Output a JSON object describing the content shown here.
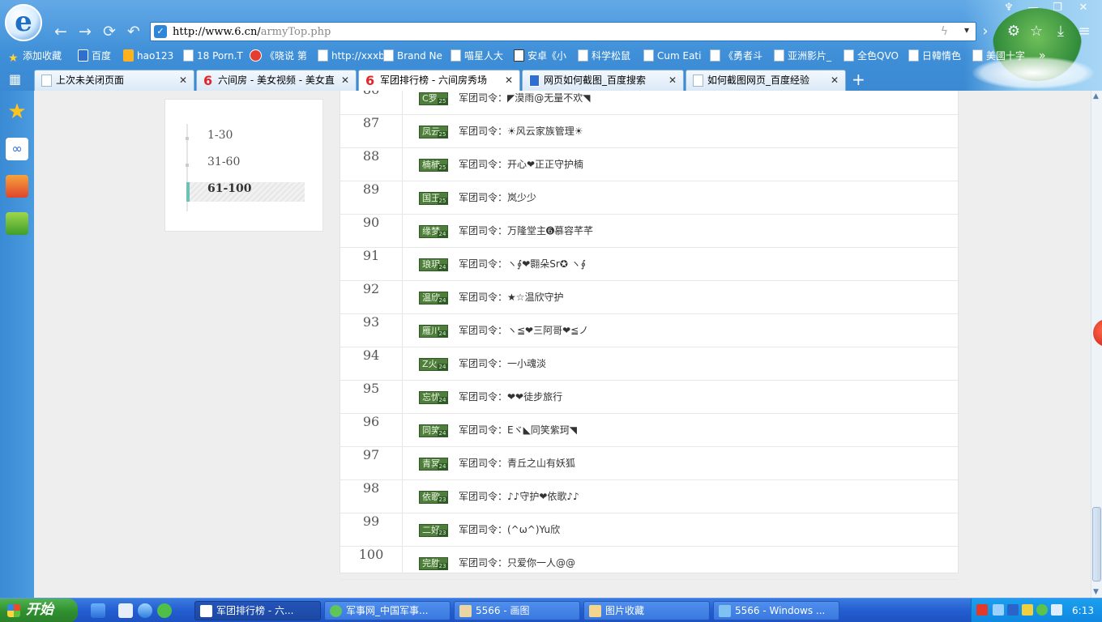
{
  "browser": {
    "logo": "e",
    "address": {
      "host": "http://www.6.cn/",
      "path": "armyTop.php"
    },
    "nav_icons": [
      "back-icon",
      "forward-icon",
      "refresh-icon",
      "undo-icon"
    ],
    "right_icons": [
      "more-icon",
      "gear-icon",
      "star-icon",
      "download-icon",
      "menu-icon"
    ]
  },
  "bookmarks": [
    {
      "label": "添加收藏",
      "icon": "star"
    },
    {
      "label": "百度",
      "icon": "paw"
    },
    {
      "label": "hao123",
      "icon": "hao"
    },
    {
      "label": "18 Porn.T",
      "icon": "page"
    },
    {
      "label": "《晓说 第",
      "icon": "red"
    },
    {
      "label": "http://xxxb",
      "icon": "page"
    },
    {
      "label": "Brand Ne",
      "icon": "page"
    },
    {
      "label": "喵星人大",
      "icon": "page"
    },
    {
      "label": "安卓《小",
      "icon": "check"
    },
    {
      "label": "科学松鼠",
      "icon": "page"
    },
    {
      "label": "Cum Eati",
      "icon": "page"
    },
    {
      "label": "《勇者斗",
      "icon": "page"
    },
    {
      "label": "亚洲影片_",
      "icon": "page"
    },
    {
      "label": "全色QVO",
      "icon": "page"
    },
    {
      "label": "日韓情色",
      "icon": "page"
    },
    {
      "label": "美國十字",
      "icon": "page"
    }
  ],
  "bookmarks_more": "»",
  "tabs": [
    {
      "label": "上次未关闭页面",
      "icon": "page",
      "active": false
    },
    {
      "label": "六间房 - 美女视频 - 美女直",
      "icon": "six",
      "active": false
    },
    {
      "label": "军团排行榜 - 六间房秀场",
      "icon": "six",
      "active": true
    },
    {
      "label": "网页如何截图_百度搜索",
      "icon": "paw",
      "active": false
    },
    {
      "label": "如何截图网页_百度经验",
      "icon": "page",
      "active": false
    }
  ],
  "tab_close": "✕",
  "new_tab": "+",
  "subnav": [
    {
      "label": "1-30",
      "active": false
    },
    {
      "label": "31-60",
      "active": false
    },
    {
      "label": "61-100",
      "active": true
    }
  ],
  "ranking": [
    {
      "rank": "86",
      "badge": "C罗",
      "level": "25",
      "command": "军团司令：◤漠雨@无量不欢◥"
    },
    {
      "rank": "87",
      "badge": "凤云",
      "level": "25",
      "command": "军团司令：☀风云家族管理☀"
    },
    {
      "rank": "88",
      "badge": "楠楠",
      "level": "25",
      "command": "军团司令：开心❤正正守护楠"
    },
    {
      "rank": "89",
      "badge": "国王",
      "level": "25",
      "command": "军团司令：岚少少"
    },
    {
      "rank": "90",
      "badge": "缘梦",
      "level": "24",
      "command": "军团司令：万隆堂主➏慕容芊芊"
    },
    {
      "rank": "91",
      "badge": "琅玥",
      "level": "24",
      "command": "军团司令：ヽ∮❤翾朵Sr✪ ヽ∮"
    },
    {
      "rank": "92",
      "badge": "温欣",
      "level": "24",
      "command": "军团司令：★☆温欣守护"
    },
    {
      "rank": "93",
      "badge": "雁川",
      "level": "24",
      "command": "军团司令：ヽ≦❤三阿哥❤≦ノ"
    },
    {
      "rank": "94",
      "badge": "Z火",
      "level": "24",
      "command": "军团司令：一小魂淡"
    },
    {
      "rank": "95",
      "badge": "忘忧",
      "level": "24",
      "command": "军团司令：❤❤徒步旅行"
    },
    {
      "rank": "96",
      "badge": "同笑",
      "level": "24",
      "command": "军团司令：Eヾ◣同笑紫珂◥"
    },
    {
      "rank": "97",
      "badge": "青冥",
      "level": "24",
      "command": "军团司令：青丘之山有妖狐"
    },
    {
      "rank": "98",
      "badge": "依歌",
      "level": "23",
      "command": "军团司令：♪♪守护❤依歌♪♪"
    },
    {
      "rank": "99",
      "badge": "二好",
      "level": "23",
      "command": "军团司令：(^ω^)Yu欣"
    },
    {
      "rank": "100",
      "badge": "完胜",
      "level": "23",
      "command": "军团司令：只爱你一人@@"
    }
  ],
  "taskbar": {
    "start": "开始",
    "tasks": [
      {
        "label": "军团排行榜 - 六...",
        "active": true
      },
      {
        "label": "军事网_中国军事...",
        "active": false
      },
      {
        "label": "5566 - 画图",
        "active": false
      },
      {
        "label": "图片收藏",
        "active": false
      },
      {
        "label": "5566 - Windows ...",
        "active": false
      }
    ],
    "clock": "6:13"
  }
}
